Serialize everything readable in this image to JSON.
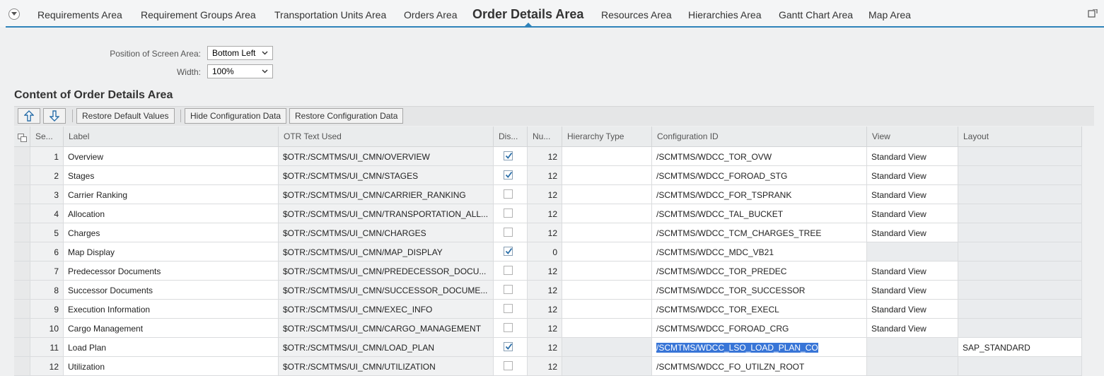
{
  "tabs": [
    {
      "label": "Requirements Area",
      "active": false
    },
    {
      "label": "Requirement Groups Area",
      "active": false
    },
    {
      "label": "Transportation Units Area",
      "active": false
    },
    {
      "label": "Orders Area",
      "active": false
    },
    {
      "label": "Order Details Area",
      "active": true
    },
    {
      "label": "Resources Area",
      "active": false
    },
    {
      "label": "Hierarchies Area",
      "active": false
    },
    {
      "label": "Gantt Chart Area",
      "active": false
    },
    {
      "label": "Map Area",
      "active": false
    }
  ],
  "settings": {
    "position_label": "Position of Screen Area:",
    "position_value": "Bottom Left",
    "width_label": "Width:",
    "width_value": "100%"
  },
  "section_title": "Content of Order Details Area",
  "toolbar": {
    "move_up": "arrow-up-icon",
    "move_down": "arrow-down-icon",
    "restore_defaults": "Restore Default Values",
    "hide_config": "Hide Configuration Data",
    "restore_config": "Restore Configuration Data"
  },
  "columns": {
    "seq": "Se...",
    "label": "Label",
    "otr": "OTR Text Used",
    "display": "Dis...",
    "number": "Nu...",
    "hierarchy": "Hierarchy Type",
    "config": "Configuration ID",
    "view": "View",
    "layout": "Layout"
  },
  "rows": [
    {
      "seq": "1",
      "label": "Overview",
      "otr": "$OTR:/SCMTMS/UI_CMN/OVERVIEW",
      "display": true,
      "number": "12",
      "hierarchy": "",
      "config": "/SCMTMS/WDCC_TOR_OVW",
      "view": "Standard View",
      "layout": ""
    },
    {
      "seq": "2",
      "label": "Stages",
      "otr": "$OTR:/SCMTMS/UI_CMN/STAGES",
      "display": true,
      "number": "12",
      "hierarchy": "",
      "config": "/SCMTMS/WDCC_FOROAD_STG",
      "view": "Standard View",
      "layout": ""
    },
    {
      "seq": "3",
      "label": "Carrier Ranking",
      "otr": "$OTR:/SCMTMS/UI_CMN/CARRIER_RANKING",
      "display": false,
      "number": "12",
      "hierarchy": "",
      "config": "/SCMTMS/WDCC_FOR_TSPRANK",
      "view": "Standard View",
      "layout": ""
    },
    {
      "seq": "4",
      "label": "Allocation",
      "otr": "$OTR:/SCMTMS/UI_CMN/TRANSPORTATION_ALL...",
      "display": false,
      "number": "12",
      "hierarchy": "",
      "config": "/SCMTMS/WDCC_TAL_BUCKET",
      "view": "Standard View",
      "layout": ""
    },
    {
      "seq": "5",
      "label": "Charges",
      "otr": "$OTR:/SCMTMS/UI_CMN/CHARGES",
      "display": false,
      "number": "12",
      "hierarchy": "",
      "config": "/SCMTMS/WDCC_TCM_CHARGES_TREE",
      "view": "Standard View",
      "layout": ""
    },
    {
      "seq": "6",
      "label": "Map Display",
      "otr": "$OTR:/SCMTMS/UI_CMN/MAP_DISPLAY",
      "display": true,
      "number": "0",
      "hierarchy": "",
      "config": "/SCMTMS/WDCC_MDC_VB21",
      "view": "",
      "layout": ""
    },
    {
      "seq": "7",
      "label": "Predecessor Documents",
      "otr": "$OTR:/SCMTMS/UI_CMN/PREDECESSOR_DOCU...",
      "display": false,
      "number": "12",
      "hierarchy": "",
      "config": "/SCMTMS/WDCC_TOR_PREDEC",
      "view": "Standard View",
      "layout": ""
    },
    {
      "seq": "8",
      "label": "Successor Documents",
      "otr": "$OTR:/SCMTMS/UI_CMN/SUCCESSOR_DOCUME...",
      "display": false,
      "number": "12",
      "hierarchy": "",
      "config": "/SCMTMS/WDCC_TOR_SUCCESSOR",
      "view": "Standard View",
      "layout": ""
    },
    {
      "seq": "9",
      "label": "Execution Information",
      "otr": "$OTR:/SCMTMS/UI_CMN/EXEC_INFO",
      "display": false,
      "number": "12",
      "hierarchy": "",
      "config": "/SCMTMS/WDCC_TOR_EXECL",
      "view": "Standard View",
      "layout": ""
    },
    {
      "seq": "10",
      "label": "Cargo Management",
      "otr": "$OTR:/SCMTMS/UI_CMN/CARGO_MANAGEMENT",
      "display": false,
      "number": "12",
      "hierarchy": "",
      "config": "/SCMTMS/WDCC_FOROAD_CRG",
      "view": "Standard View",
      "layout": ""
    },
    {
      "seq": "11",
      "label": "Load Plan",
      "otr": "$OTR:/SCMTMS/UI_CMN/LOAD_PLAN",
      "display": true,
      "number": "12",
      "hierarchy": "",
      "config": "/SCMTMS/WDCC_LSO_LOAD_PLAN_CO",
      "view": "",
      "layout": "SAP_STANDARD"
    },
    {
      "seq": "12",
      "label": "Utilization",
      "otr": "$OTR:/SCMTMS/UI_CMN/UTILIZATION",
      "display": false,
      "number": "12",
      "hierarchy": "",
      "config": "/SCMTMS/WDCC_FO_UTILZN_ROOT",
      "view": "",
      "layout": ""
    }
  ],
  "colors": {
    "accent": "#2f83ba",
    "selection": "#3875d7",
    "check": "#2a6ea8"
  }
}
